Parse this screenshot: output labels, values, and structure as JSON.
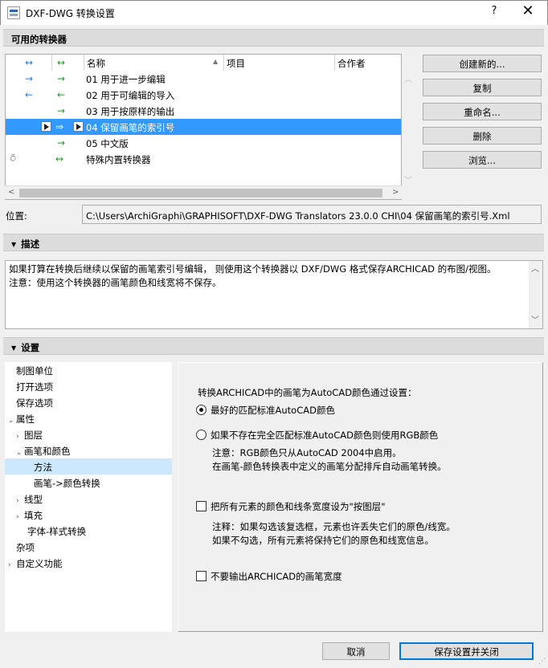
{
  "window": {
    "title": "DXF-DWG 转换设置",
    "help_label": "?",
    "close_label": "✕"
  },
  "available": {
    "header": "可用的转换器",
    "columns": {
      "col1": "↔",
      "col2": "↔",
      "name": "名称",
      "sort": "▲",
      "project": "项目",
      "partner": "合作者"
    },
    "rows": [
      {
        "a1": "→",
        "a2": "→",
        "name": "01 用于进一步编辑"
      },
      {
        "a1": "←",
        "a2": "←",
        "name": "02 用于可编辑的导入"
      },
      {
        "a1": "",
        "a2": "→",
        "name": "03 用于按原样的输出"
      },
      {
        "a1": "⇒",
        "a2": "⇒",
        "name": "04 保留画笔的索引号"
      },
      {
        "a1": "",
        "a2": "→",
        "name": "05 中文版"
      },
      {
        "a1": "",
        "a2": "↔",
        "name": "特殊内置转换器",
        "lock": "⍥"
      }
    ],
    "scroll_left": "<",
    "scroll_right": ">",
    "scroll_up": "︿",
    "scroll_down": "﹀",
    "buttons": {
      "create": "创建新的...",
      "duplicate": "复制",
      "rename": "重命名...",
      "delete": "删除",
      "browse": "浏览..."
    },
    "location_label": "位置:",
    "location_value": "C:\\Users\\ArchiGraphi\\GRAPHISOFT\\DXF-DWG Translators 23.0.0 CHI\\04 保留画笔的索引号.Xml"
  },
  "description": {
    "header": "描述",
    "line1": "如果打算在转换后继续以保留的画笔索引号编辑， 则使用这个转换器以 DXF/DWG 格式保存ARCHICAD 的布图/视图。",
    "line2": "注意：使用这个转换器的画笔颜色和线宽将不保存。",
    "scroll_up": "︿",
    "scroll_down": "﹀"
  },
  "settings": {
    "header": "设置",
    "tree": [
      {
        "label": "制图单位",
        "toggle": "",
        "indent": 0
      },
      {
        "label": "打开选项",
        "toggle": "",
        "indent": 0
      },
      {
        "label": "保存选项",
        "toggle": "",
        "indent": 0
      },
      {
        "label": "属性",
        "toggle": "⌄",
        "indent": 0
      },
      {
        "label": "图层",
        "toggle": "›",
        "indent": 1
      },
      {
        "label": "画笔和颜色",
        "toggle": "⌄",
        "indent": 1
      },
      {
        "label": "方法",
        "toggle": "",
        "indent": 2,
        "selected": true
      },
      {
        "label": "画笔->颜色转换",
        "toggle": "",
        "indent": 2
      },
      {
        "label": "线型",
        "toggle": "›",
        "indent": 1
      },
      {
        "label": "填充",
        "toggle": "›",
        "indent": 1
      },
      {
        "label": "字体-样式转换",
        "toggle": "",
        "indent": 2
      },
      {
        "label": "杂项",
        "toggle": "",
        "indent": 0
      },
      {
        "label": "自定义功能",
        "toggle": "›",
        "indent": 0
      }
    ],
    "panel": {
      "heading": "转换ARCHICAD中的画笔为AutoCAD颜色通过设置：",
      "radio1": "最好的匹配标准AutoCAD颜色",
      "radio1_checked": true,
      "radio2": "如果不存在完全匹配标准AutoCAD颜色则使用RGB颜色",
      "radio2_checked": false,
      "note1_line1": "注意：RGB颜色只从AutoCAD 2004中启用。",
      "note1_line2": "在画笔-颜色转换表中定义的画笔分配排斥自动画笔转换。",
      "check1": "把所有元素的颜色和线条宽度设为\"按图层\"",
      "check1_checked": false,
      "note2_line1": "注释：如果勾选该复选框，元素也许丢失它们的原色/线宽。",
      "note2_line2": "如果不勾选，所有元素将保持它们的原色和线宽信息。",
      "check2": "不要输出ARCHICAD的画笔宽度",
      "check2_checked": false
    }
  },
  "footer": {
    "cancel": "取消",
    "save_close": "保存设置并关闭"
  },
  "colors": {
    "selection": "#3399ff",
    "tree_selection": "#cce8ff",
    "arrow_green": "#2a9a2a",
    "arrow_blue": "#2d7de0",
    "primary_border": "#0078d7"
  }
}
